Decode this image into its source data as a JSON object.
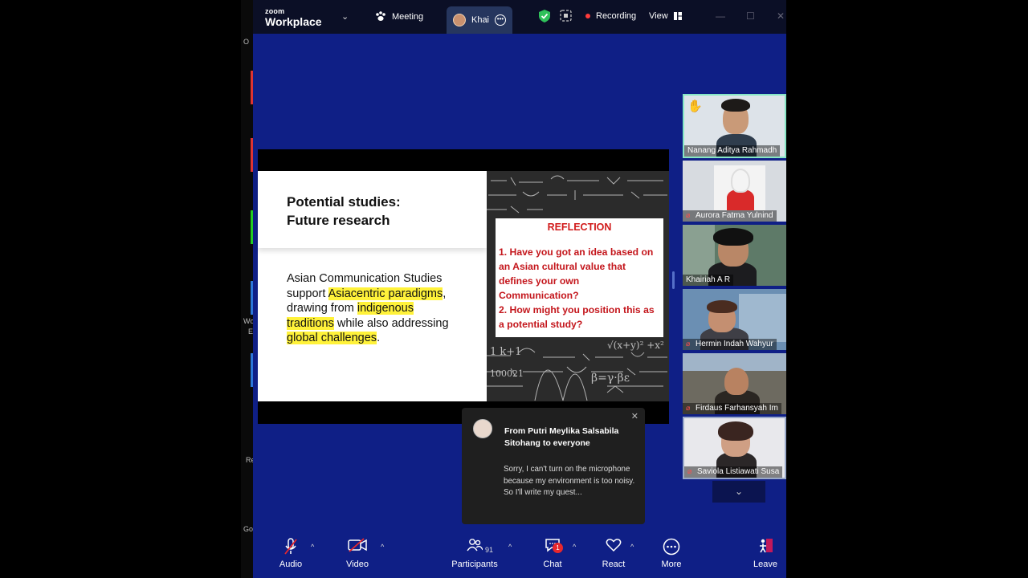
{
  "bg_app": {
    "labels": [
      "O",
      "Wo",
      "E",
      "Re",
      "Go"
    ]
  },
  "titlebar": {
    "logo_top": "zoom",
    "logo_bottom": "Workplace",
    "meeting_tab": "Meeting",
    "user_tab": "Khai",
    "recording": "Recording",
    "view": "View"
  },
  "slide": {
    "title": "Potential studies:\nFuture research",
    "body_parts": [
      "Asian Communication Studies support ",
      "Asiacentric paradigms",
      ", drawing from ",
      "indigenous traditions",
      " while also addressing ",
      "global challenges",
      "."
    ],
    "reflection_title": "REFLECTION",
    "reflection_text": "1. Have you got an idea based on an Asian cultural value that defines your own Communication?\n2. How might you position this as a potential study?"
  },
  "participants": [
    {
      "name": "Nanang Aditya Rahmadh"
    },
    {
      "name": "Aurora Fatma Yulnind"
    },
    {
      "name": "Khairiah A R"
    },
    {
      "name": "Hermin Indah Wahyur"
    },
    {
      "name": "Firdaus Farhansyah Im"
    },
    {
      "name": "Saviola Listiawati Susa"
    }
  ],
  "chat_toast": {
    "from": "From Putri Meylika Salsabila Sitohang to everyone",
    "message": "Sorry, I can't turn on the microphone because my environment is too noisy. So I'll write my quest..."
  },
  "toolbar": {
    "audio": "Audio",
    "video": "Video",
    "participants": "Participants",
    "participants_count": "91",
    "chat": "Chat",
    "chat_badge": "1",
    "react": "React",
    "more": "More",
    "leave": "Leave"
  },
  "colors": {
    "window_bg": "#0f1f86",
    "titlebar_bg": "#0b0f26",
    "highlight": "#fff23a",
    "reflection_red": "#c4161c",
    "active_speaker_border": "#86e6c5"
  }
}
